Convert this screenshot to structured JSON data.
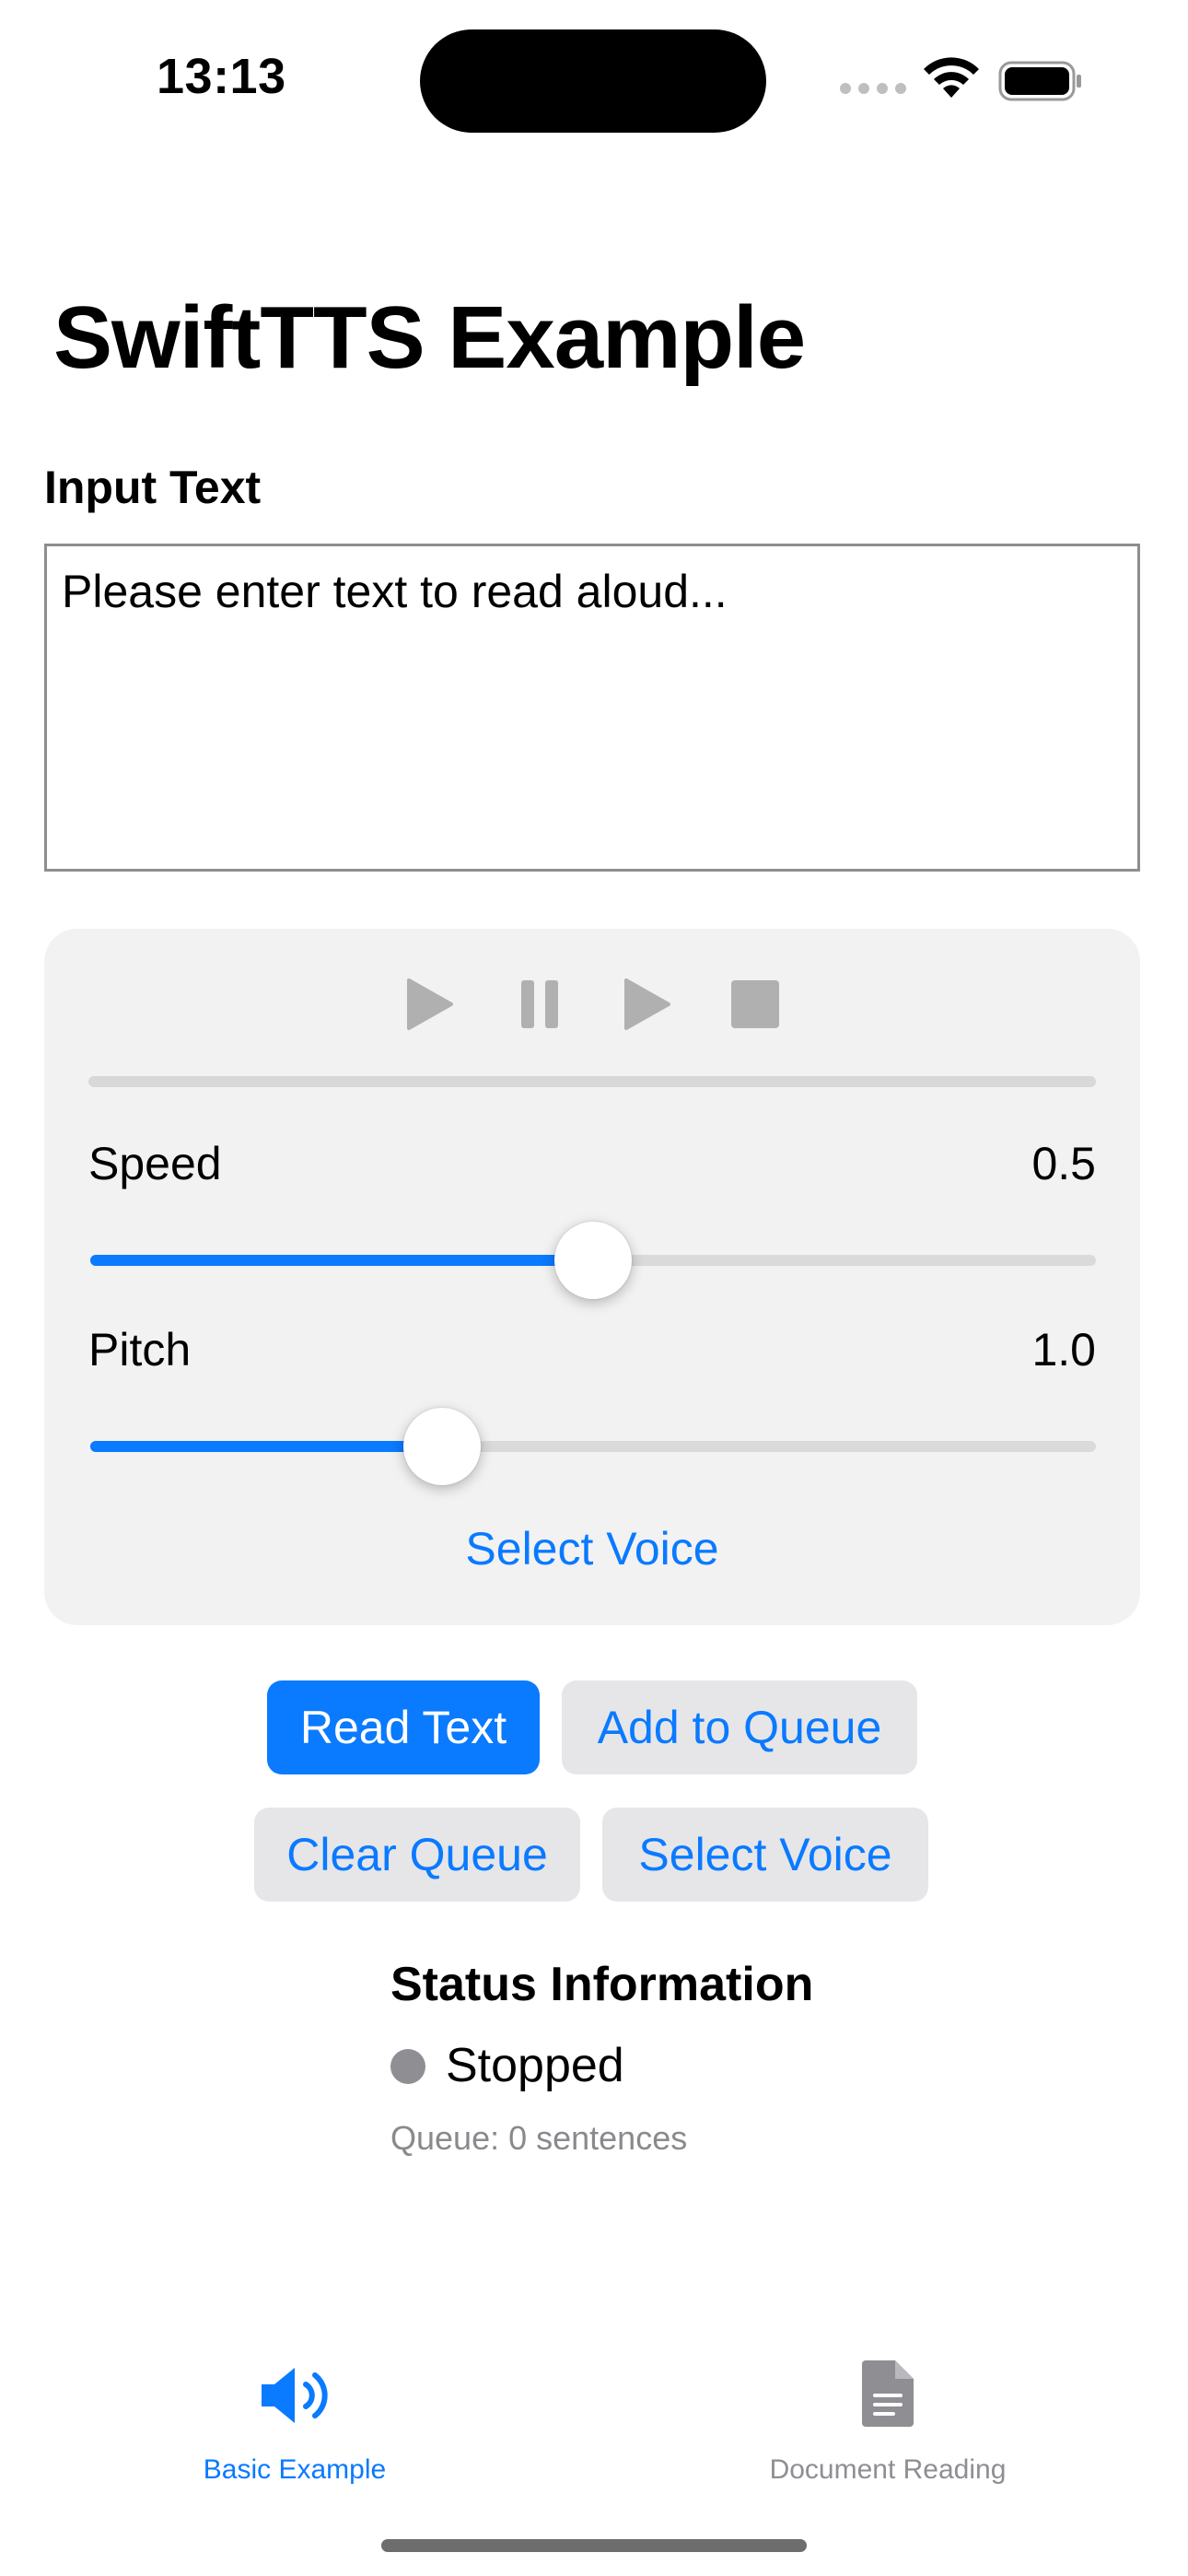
{
  "status_bar": {
    "time": "13:13"
  },
  "header": {
    "title": "SwiftTTS Example"
  },
  "input": {
    "label": "Input Text",
    "placeholder": "Please enter text to read aloud..."
  },
  "controls": {
    "play_icon": "play-icon",
    "pause_icon": "pause-icon",
    "resume_icon": "resume-icon",
    "stop_icon": "stop-icon",
    "speed": {
      "label": "Speed",
      "value": "0.5",
      "level": 0.5
    },
    "pitch": {
      "label": "Pitch",
      "value": "1.0",
      "level": 0.35
    },
    "select_voice": "Select Voice"
  },
  "buttons": {
    "read_text": "Read Text",
    "add_to_queue": "Add to Queue",
    "clear_queue": "Clear Queue",
    "select_voice": "Select Voice"
  },
  "status": {
    "title": "Status Information",
    "state": "Stopped",
    "queue": "Queue: 0 sentences"
  },
  "tabs": [
    {
      "label": "Basic Example",
      "icon": "speaker-icon",
      "active": true
    },
    {
      "label": "Document Reading",
      "icon": "document-icon",
      "active": false
    }
  ],
  "colors": {
    "accent": "#0a7aff",
    "disabled": "#b0b0b0",
    "status_dot": "#8e8e93"
  }
}
